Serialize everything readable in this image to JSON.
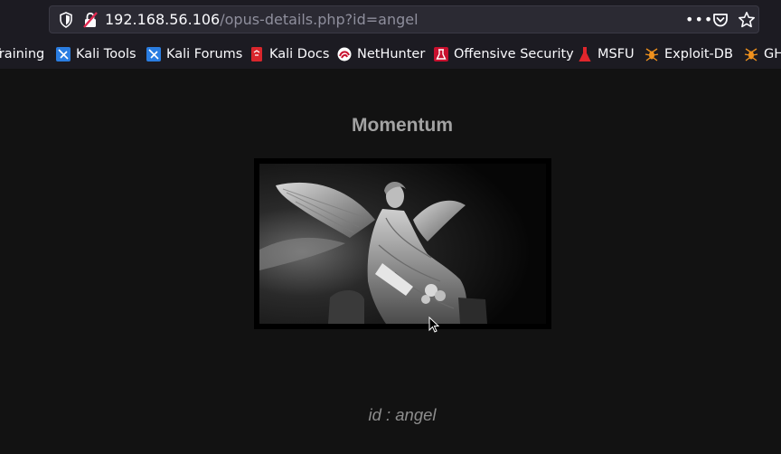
{
  "browser": {
    "url_host": "192.168.56.106",
    "url_path": "/opus-details.php?id=angel",
    "menu_glyph": "•••"
  },
  "bookmarks": [
    {
      "label": "Training",
      "icon": "bookmark-icon"
    },
    {
      "label": "Kali Tools",
      "icon": "kali-icon"
    },
    {
      "label": "Kali Forums",
      "icon": "kali-icon"
    },
    {
      "label": "Kali Docs",
      "icon": "docs-icon"
    },
    {
      "label": "NetHunter",
      "icon": "nethunter-icon"
    },
    {
      "label": "Offensive Security",
      "icon": "offsec-icon"
    },
    {
      "label": "MSFU",
      "icon": "msfu-icon"
    },
    {
      "label": "Exploit-DB",
      "icon": "exploitdb-icon"
    },
    {
      "label": "GH",
      "icon": "exploitdb-icon"
    }
  ],
  "page": {
    "title": "Momentum",
    "image_alt": "angel statue",
    "caption": "id : angel"
  },
  "colors": {
    "background": "#121212",
    "toolbar": "#1c1b22",
    "title": "#a2a2a2",
    "caption": "#8d8d8d"
  }
}
